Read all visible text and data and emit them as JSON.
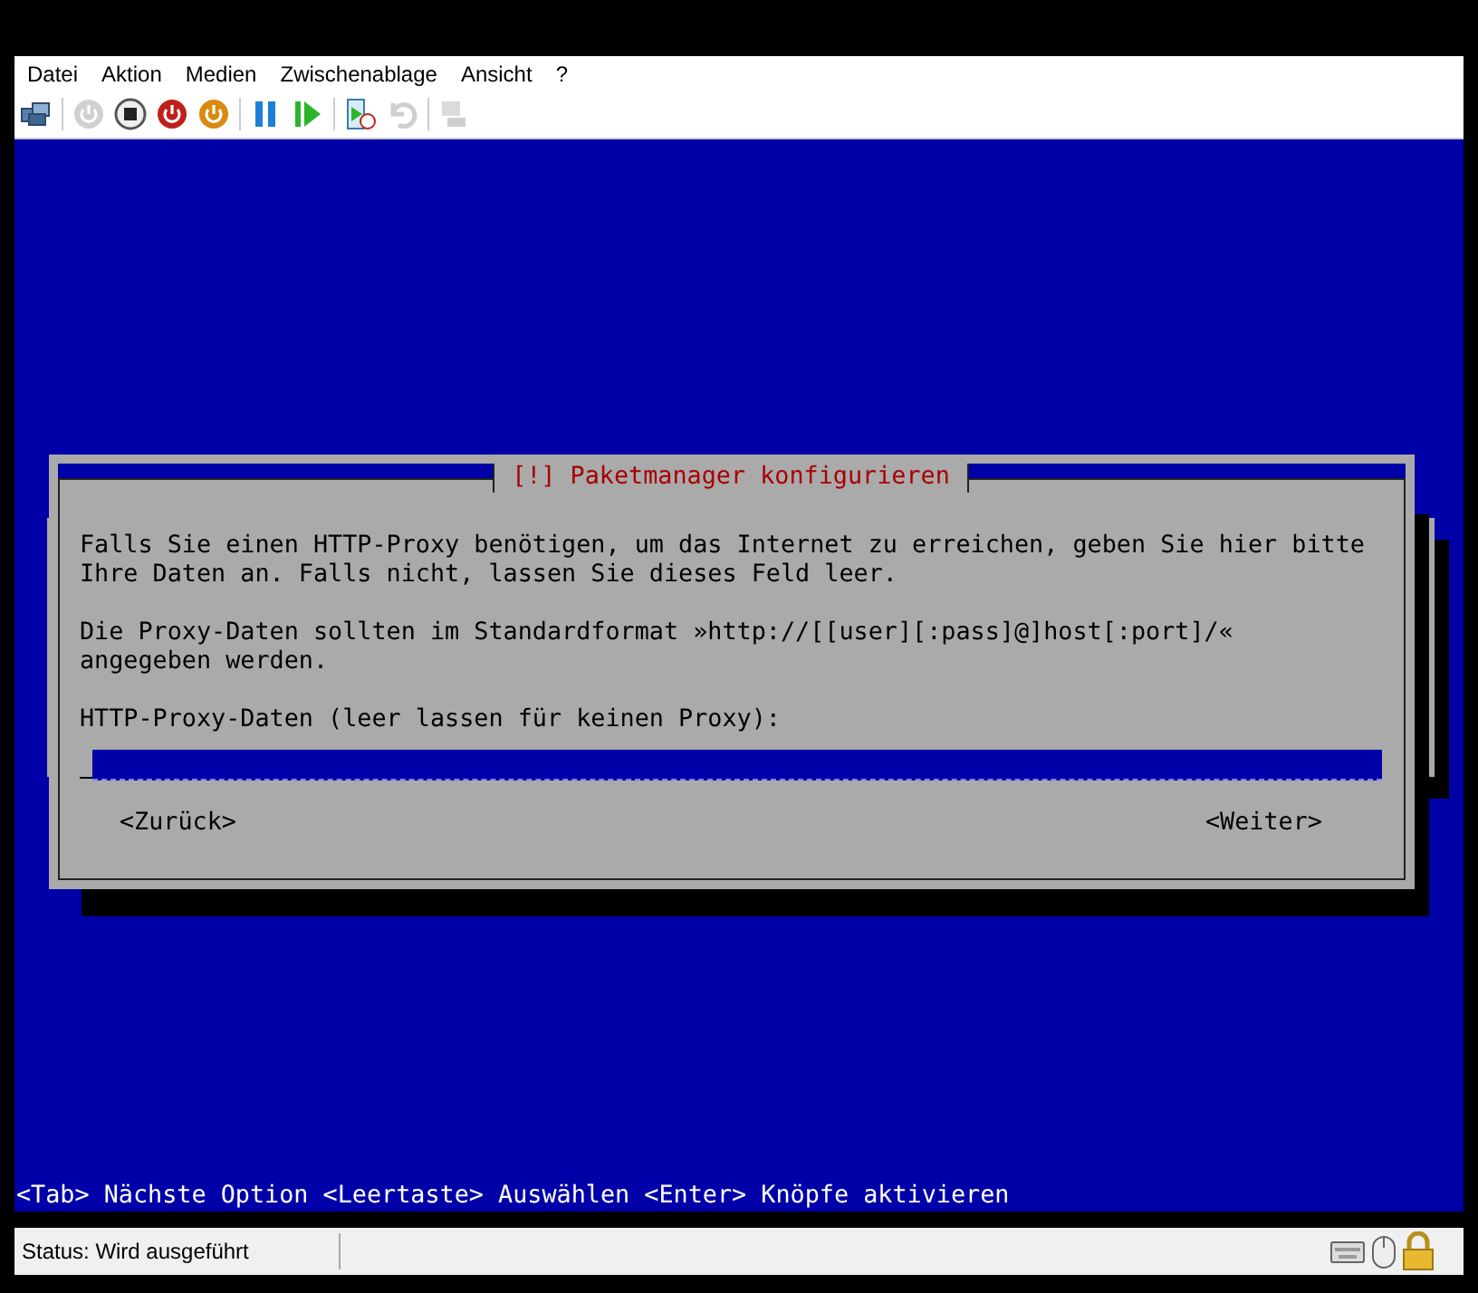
{
  "menu": [
    "Datei",
    "Aktion",
    "Medien",
    "Zwischenablage",
    "Ansicht",
    "?"
  ],
  "toolbar": [
    [
      {
        "kind": "ctrl-alt-del",
        "disabled": false
      }
    ],
    [
      {
        "kind": "start",
        "disabled": true
      },
      {
        "kind": "turn-off",
        "disabled": false
      },
      {
        "kind": "shutdown",
        "disabled": false
      },
      {
        "kind": "save",
        "disabled": false
      }
    ],
    [
      {
        "kind": "pause",
        "disabled": false
      },
      {
        "kind": "resume",
        "disabled": false
      }
    ],
    [
      {
        "kind": "checkpoint",
        "disabled": false
      },
      {
        "kind": "revert",
        "disabled": true
      }
    ],
    [
      {
        "kind": "enhanced",
        "disabled": true
      }
    ]
  ],
  "dialog": {
    "title": "[!] Paketmanager konfigurieren",
    "paragraphs": [
      "Falls Sie einen HTTP-Proxy benötigen, um das Internet zu erreichen, geben Sie hier bitte Ihre Daten an. Falls nicht, lassen Sie dieses Feld leer.",
      "Die Proxy-Daten sollten im Standardformat »http://[[user][:pass]@]host[:port]/« angegeben werden."
    ],
    "prompt": "HTTP-Proxy-Daten (leer lassen für keinen Proxy):",
    "field": {
      "focused": true
    },
    "buttons": [
      {
        "label": "<Zurück>",
        "selected": false
      },
      {
        "label": "<Weiter>",
        "selected": false
      }
    ]
  },
  "help_line": "<Tab> Nächste Option <Leertaste> Auswählen <Enter> Knöpfe aktivieren",
  "status_bar": {
    "status": "Status: Wird ausgeführt"
  }
}
